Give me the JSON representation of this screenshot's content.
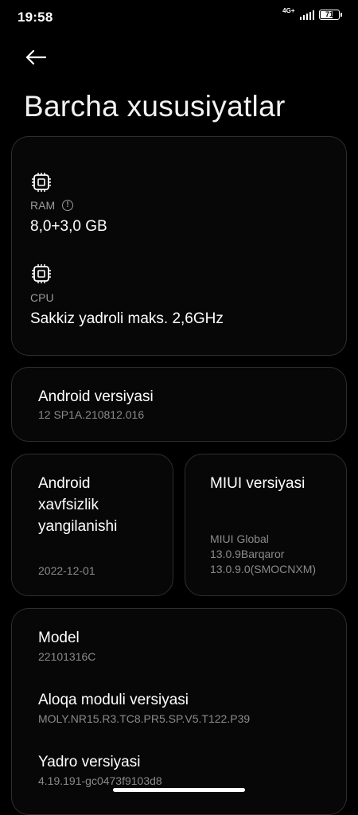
{
  "status": {
    "time": "19:58",
    "network": "4G+",
    "battery": "71",
    "battery_level": 0.71
  },
  "header": {
    "title": "Barcha xususiyatlar"
  },
  "hardware": {
    "ram_label": "RAM",
    "ram_value": "8,0+3,0 GB",
    "cpu_label": "CPU",
    "cpu_value": "Sakkiz yadroli maks. 2,6GHz"
  },
  "android_version": {
    "title": "Android versiyasi",
    "value": "12 SP1A.210812.016"
  },
  "security_update": {
    "title_lines": [
      "Android",
      "xavfsizlik",
      "yangilanishi"
    ],
    "value": "2022-12-01"
  },
  "miui_version": {
    "title": "MIUI versiyasi",
    "value_lines": [
      "MIUI Global",
      "13.0.9Barqaror",
      "13.0.9.0(SMOCNXM)"
    ]
  },
  "model": {
    "title": "Model",
    "value": "22101316C"
  },
  "baseband": {
    "title": "Aloqa moduli versiyasi",
    "value": "MOLY.NR15.R3.TC8.PR5.SP.V5.T122.P39"
  },
  "kernel": {
    "title": "Yadro versiyasi",
    "value": "4.19.191-gc0473f9103d8"
  }
}
